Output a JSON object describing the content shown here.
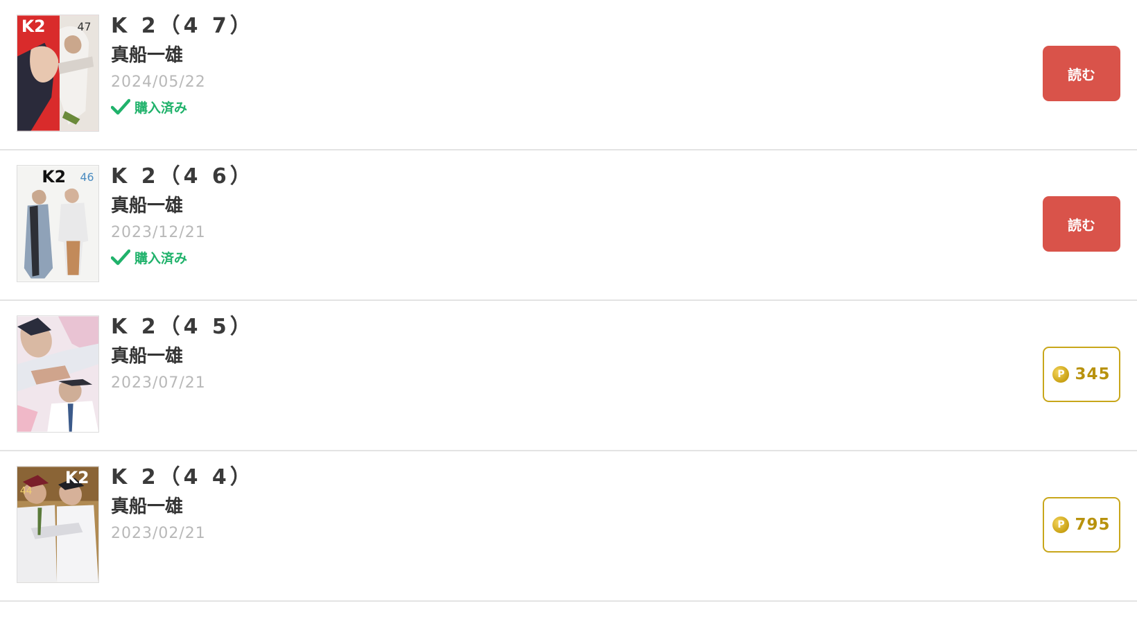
{
  "items": [
    {
      "title": "K 2（4 7）",
      "author": "真船一雄",
      "date": "2024/05/22",
      "status": "購入済み",
      "action_label": "読む"
    },
    {
      "title": "K 2（4 6）",
      "author": "真船一雄",
      "date": "2023/12/21",
      "status": "購入済み",
      "action_label": "読む"
    },
    {
      "title": "K 2（4 5）",
      "author": "真船一雄",
      "date": "2023/07/21",
      "coin_symbol": "P",
      "price": "345"
    },
    {
      "title": "K 2（4 4）",
      "author": "真船一雄",
      "date": "2023/02/21",
      "coin_symbol": "P",
      "price": "795"
    }
  ],
  "colors": {
    "read_button": "#d9534a",
    "price_border": "#c8a61a",
    "price_text": "#b8920e",
    "purchased_text": "#20b26b",
    "date_text": "#b8b8b8",
    "divider": "#e3e3e3"
  },
  "icons": {
    "purchased": "checkmark-icon",
    "coin": "point-coin-icon"
  }
}
